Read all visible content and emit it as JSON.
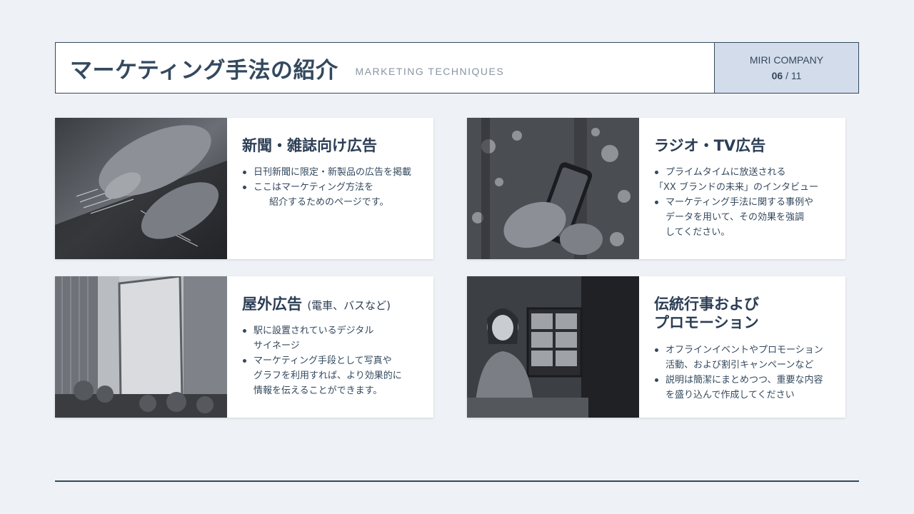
{
  "header": {
    "title": "マーケティング手法の紹介",
    "subtitle": "MARKETING TECHNIQUES",
    "company": "MIRI COMPANY",
    "page_current": "06",
    "page_total": "/ 11"
  },
  "cards": [
    {
      "title": "新聞・雑誌向け広告",
      "bullets": [
        "日刊新聞に限定・新製品の広告を掲載",
        "ここはマーケティング方法を"
      ],
      "continuation": "紹介するためのページです。",
      "image": "hand-tablet-photo"
    },
    {
      "title": "ラジオ・TV広告",
      "bullets": [
        "プライムタイムに放送される",
        "マーケティング手法に関する事例や"
      ],
      "bullet1_line2": "「XX ブランドの未来」のインタビュー",
      "bullet2_line2": "データを用いて、その効果を強調",
      "bullet2_line3": "してください。",
      "image": "phone-night-photo"
    },
    {
      "title": "屋外広告",
      "title_paren": "(電車、バスなど)",
      "bullets": [
        "駅に設置されているデジタル",
        "マーケティング手段として写真や"
      ],
      "bullet1_line2": "サイネージ",
      "bullet2_line2": "グラフを利用すれば、より効果的に",
      "bullet2_line3": "情報を伝えることができます。",
      "image": "billboard-city-photo"
    },
    {
      "title_line1": "伝統行事および",
      "title_line2": "プロモーション",
      "bullets": [
        "オフラインイベントやプロモーション",
        "説明は簡潔にまとめつつ、重要な内容"
      ],
      "bullet1_line2": "活動、および割引キャンペーンなど",
      "bullet2_line2": "を盛り込んで作成してください",
      "image": "video-call-photo"
    }
  ],
  "colors": {
    "accent": "#34495e",
    "side_panel": "#d3dcea",
    "background": "#eef1f5"
  }
}
